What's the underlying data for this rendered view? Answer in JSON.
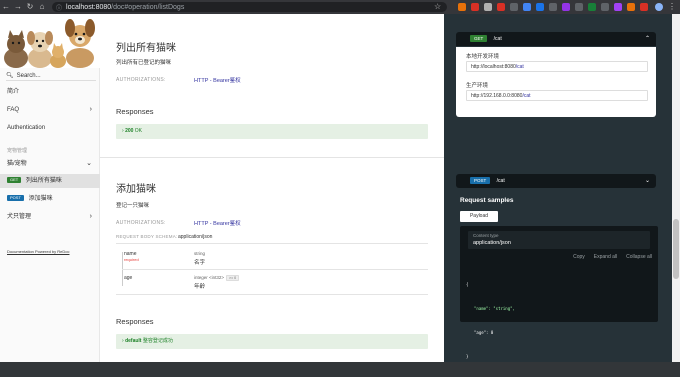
{
  "browser": {
    "url_host": "localhost:8080",
    "url_path": "/doc#operation/listDogs"
  },
  "sidebar": {
    "search_placeholder": "Search...",
    "items": [
      {
        "label": "简介"
      },
      {
        "label": "FAQ"
      },
      {
        "label": "Authentication"
      },
      {
        "label": "宠物管理"
      },
      {
        "label": "猫/宠物"
      },
      {
        "label": "列出所有猫咪",
        "method": "GET"
      },
      {
        "label": "添加猫咪",
        "method": "POST"
      },
      {
        "label": "犬只管理"
      }
    ],
    "footer": "Documentation Powered by ReDoc"
  },
  "op1": {
    "title": "列出所有猫咪",
    "description": "列出所有已登记的猫咪",
    "auth_label": "AUTHORIZATIONS:",
    "auth_value": "HTTP - Bearer鉴权",
    "responses_title": "Responses",
    "response_code": "200",
    "response_text": "OK"
  },
  "op2": {
    "title": "添加猫咪",
    "description": "登记一只猫咪",
    "auth_label": "AUTHORIZATIONS:",
    "auth_value": "HTTP - Bearer鉴权",
    "schema_label": "REQUEST BODY SCHEMA:",
    "schema_type": "application/json",
    "props": [
      {
        "name": "name",
        "required": "required",
        "type": "string",
        "desc": "名字"
      },
      {
        "name": "age",
        "type": "integer <int32>",
        "format": ">= 0",
        "desc": "年龄"
      }
    ],
    "responses_title": "Responses",
    "response_code": "default",
    "response_text": "整容登记成功"
  },
  "right": {
    "op1": {
      "method": "GET",
      "path": "/cat"
    },
    "servers": [
      {
        "label": "本地开发环境",
        "host": "http://localhost:8080",
        "path": "/cat"
      },
      {
        "label": "生产环境",
        "host": "http://192.168.0.0:8080",
        "path": "/cat"
      }
    ],
    "op2": {
      "method": "POST",
      "path": "/cat"
    },
    "samples_title": "Request samples",
    "tab": "Payload",
    "content_type_label": "Content type",
    "content_type": "application/json",
    "actions": [
      "Copy",
      "Expand all",
      "Collapse all"
    ],
    "code": [
      "{",
      "\"name\": \"string\",",
      "\"age\": 0",
      "}"
    ]
  },
  "colors": {
    "get": "#2f8132",
    "post": "#186fab",
    "link": "#32329f",
    "panel": "#263238"
  }
}
